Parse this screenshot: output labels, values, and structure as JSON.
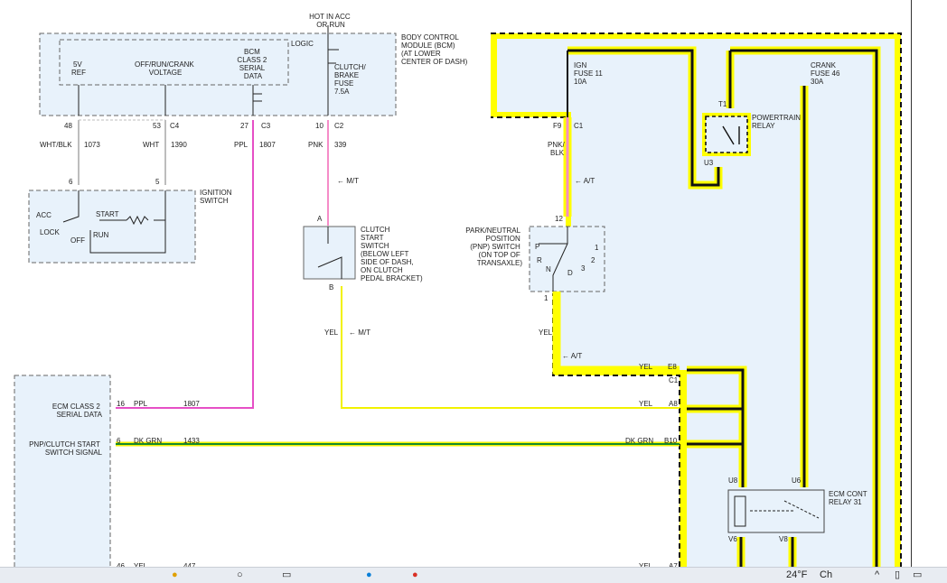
{
  "diagram": {
    "bcm": {
      "top_label": [
        "HOT IN ACC",
        "OR RUN"
      ],
      "module_label": [
        "BODY CONTROL",
        "MODULE (BCM)",
        "(AT LOWER",
        "CENTER OF DASH)"
      ],
      "logic_label": "LOGIC",
      "ref_5v": [
        "5V",
        "REF"
      ],
      "voltage": [
        "OFF/RUN/CRANK",
        "VOLTAGE"
      ],
      "serial": [
        "BCM",
        "CLASS 2",
        "SERIAL",
        "DATA"
      ],
      "fuse": [
        "CLUTCH/",
        "BRAKE",
        "FUSE",
        "7.5A"
      ]
    },
    "pins": {
      "p48": "48",
      "p53": "53",
      "c4": "C4",
      "p27": "27",
      "c3": "C3",
      "p10": "10",
      "c2": "C2",
      "p6": "6",
      "p5": "5",
      "p12": "12",
      "p1": "1",
      "f9": "F9",
      "c1": "C1",
      "e8": "E8",
      "a8": "A8",
      "b10": "B10",
      "c1b": "C1",
      "u8": "U8",
      "u6": "U6",
      "v6": "V6",
      "v8": "V8",
      "pin16": "16",
      "pin6": "6",
      "pin46": "46",
      "a7": "A7",
      "t1": "T1",
      "u3": "U3",
      "a": "A",
      "b": "B"
    },
    "wires": {
      "wht_blk": "WHT/BLK",
      "n1073": "1073",
      "wht": "WHT",
      "n1390": "1390",
      "ppl": "PPL",
      "n1807": "1807",
      "pnk": "PNK",
      "n339": "339",
      "pnk_blk": [
        "PNK/",
        "BLK"
      ],
      "yel": "YEL",
      "dk_grn": "DK GRN",
      "n1433": "1433",
      "n447": "447"
    },
    "markers": {
      "mt": "M/T",
      "at": "A/T"
    },
    "ignition": {
      "label": [
        "IGNITION",
        "SWITCH"
      ],
      "acc": "ACC",
      "lock": "LOCK",
      "off": "OFF",
      "start": "START",
      "run": "RUN"
    },
    "clutch": {
      "label": [
        "CLUTCH",
        "START",
        "SWITCH",
        "(BELOW LEFT",
        "SIDE OF DASH,",
        "ON CLUTCH",
        "PEDAL BRACKET)"
      ]
    },
    "pnp": {
      "label": [
        "PARK/NEUTRAL",
        "POSITION",
        "(PNP) SWITCH",
        "(ON TOP OF",
        "TRANSAXLE)"
      ],
      "P": "P",
      "R": "R",
      "N": "N",
      "D": "D",
      "g1": "1",
      "g2": "2",
      "g3": "3"
    },
    "ign_fuse": [
      "IGN",
      "FUSE 11",
      "10A"
    ],
    "crank_fuse": [
      "CRANK",
      "FUSE 46",
      "30A"
    ],
    "pt_relay": [
      "POWERTRAIN",
      "RELAY"
    ],
    "ecm": {
      "serial": [
        "ECM CLASS 2",
        "SERIAL DATA"
      ],
      "pnp_signal": [
        "PNP/CLUTCH START",
        "SWITCH SIGNAL"
      ]
    },
    "ecm_relay": [
      "ECM CONT",
      "RELAY 31"
    ]
  },
  "taskbar": {
    "weather": "24°F",
    "news": "Ch"
  },
  "colors": {
    "panel": "#e8f2fb",
    "wire_pink": "#e64fc6",
    "wire_yellow": "#f2f200",
    "wire_green": "#138a2e",
    "wire_gray": "#bdbdbd",
    "highlight": "#ffff00",
    "taskbar": "#e8ecf2"
  }
}
